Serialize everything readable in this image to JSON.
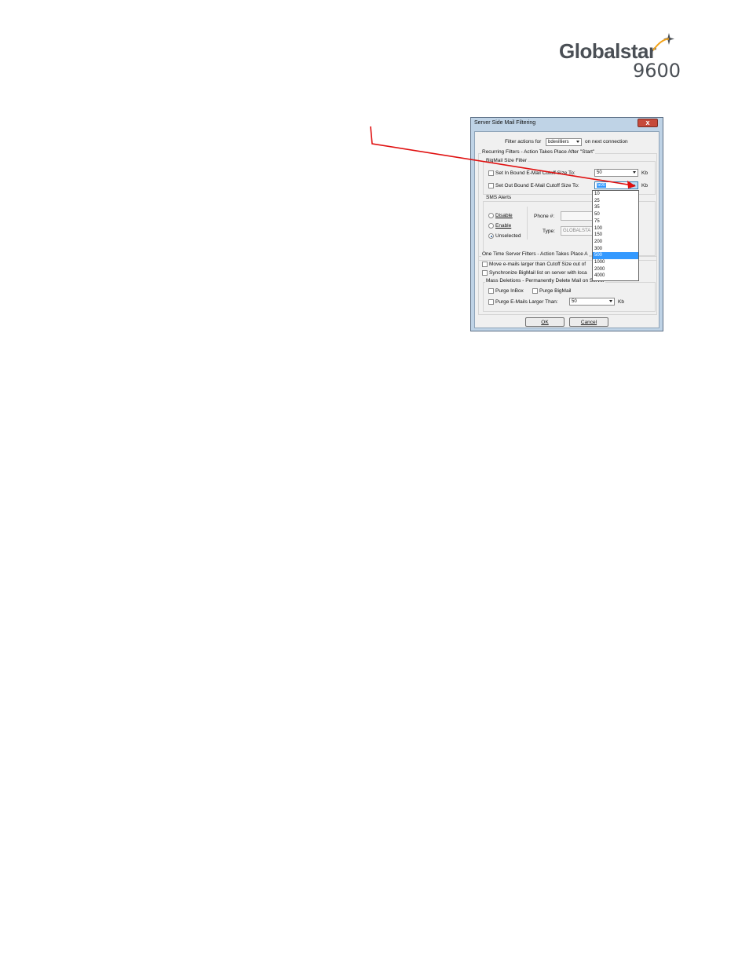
{
  "logo": {
    "wordmark": "Globalstar",
    "model": "9600"
  },
  "dialog": {
    "title": "Server Side Mail Filtering",
    "close_label": "x",
    "filter_for": {
      "prefix": "Filter actions for",
      "account": "bdevilliers",
      "suffix": "on next connection"
    },
    "recurring": {
      "heading": "Recurring Filters - Action Takes Place After \"Start\"",
      "bigmail": {
        "heading": "BigMail Size Filter",
        "inbound_label": "Set In Bound E-Mail Cutoff Size To:",
        "inbound_value": "50",
        "outbound_label": "Set Out Bound E-Mail Cutoff Size To:",
        "outbound_value": "500",
        "unit": "Kb"
      },
      "sms": {
        "heading": "SMS Alerts",
        "options": [
          "Disable",
          "Enable",
          "Unselected"
        ],
        "selected": "Unselected",
        "phone_label": "Phone #:",
        "type_label": "Type:",
        "type_value": "GLOBALSTA"
      }
    },
    "one_time": {
      "heading": "One Time Server Filters - Action Takes Place A",
      "move_label": "Move e-mails larger than Cutoff Size out of",
      "sync_label": "Synchronize BigMail list on server with loca",
      "mass": {
        "heading": "Mass Deletions - Permanently Delete Mail on Server",
        "purge_inbox": "Purge InBox",
        "purge_bigmail": "Purge BigMail",
        "purge_larger": "Purge E-Mails Larger Than:",
        "purge_value": "50",
        "unit": "Kb"
      }
    },
    "ok_label": "OK",
    "cancel_label": "Cancel",
    "dropdown": {
      "options": [
        "10",
        "25",
        "35",
        "50",
        "75",
        "100",
        "150",
        "200",
        "300",
        "500",
        "1000",
        "2000",
        "4000"
      ],
      "selected": "500"
    }
  },
  "colors": {
    "callout": "#e01010",
    "selection": "#3399ff"
  }
}
